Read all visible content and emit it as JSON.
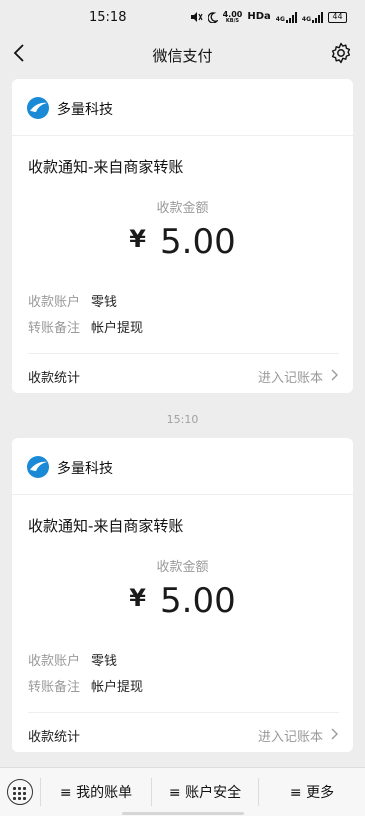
{
  "status_bar": {
    "time": "15:18",
    "speed": "4.00",
    "speed_unit": "KB/S",
    "hd": "HDa",
    "net1": "4G",
    "net2": "4G",
    "battery": "44"
  },
  "nav": {
    "title": "微信支付"
  },
  "messages": [
    {
      "merchant": "多量科技",
      "notice": "收款通知-来自商家转账",
      "amount_label": "收款金额",
      "currency": "¥",
      "amount": "5.00",
      "account_key": "收款账户",
      "account_value": "零钱",
      "remark_key": "转账备注",
      "remark_value": "帐户提现",
      "footer_left": "收款统计",
      "footer_link": "进入记账本"
    },
    {
      "merchant": "多量科技",
      "notice": "收款通知-来自商家转账",
      "amount_label": "收款金额",
      "currency": "¥",
      "amount": "5.00",
      "account_key": "收款账户",
      "account_value": "零钱",
      "remark_key": "转账备注",
      "remark_value": "帐户提现",
      "footer_left": "收款统计",
      "footer_link": "进入记账本"
    }
  ],
  "timestamp": "15:10",
  "bottom_menu": {
    "items": [
      "≡ 我的账单",
      "≡ 账户安全",
      "≡ 更多"
    ]
  },
  "colors": {
    "background": "#ededed",
    "card": "#ffffff",
    "logo_blue": "#1a8ad6",
    "muted_text": "#9a9a9a"
  }
}
